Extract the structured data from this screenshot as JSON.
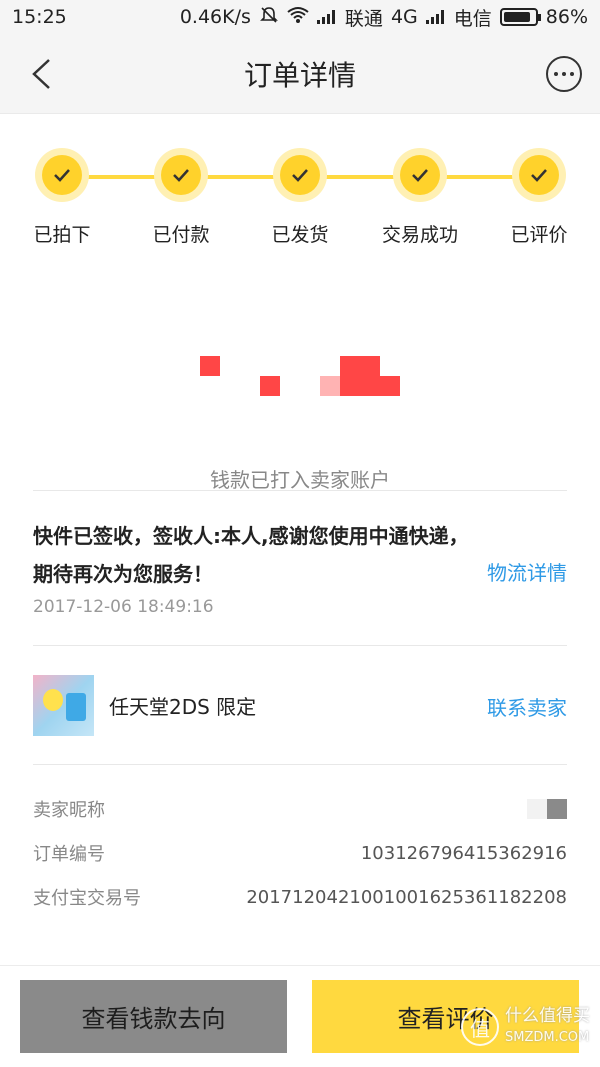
{
  "status_bar": {
    "time": "15:25",
    "speed": "0.46K/s",
    "carrier1": "联通",
    "net1": "4G",
    "carrier2": "电信",
    "battery": "86%"
  },
  "nav": {
    "title": "订单详情"
  },
  "steps": [
    {
      "label": "已拍下"
    },
    {
      "label": "已付款"
    },
    {
      "label": "已发货"
    },
    {
      "label": "交易成功"
    },
    {
      "label": "已评价"
    }
  ],
  "status": {
    "message": "钱款已打入卖家账户"
  },
  "logistics": {
    "message": "快件已签收，签收人:本人,感谢您使用中通快递，期待再次为您服务！",
    "time": "2017-12-06 18:49:16",
    "link": "物流详情"
  },
  "product": {
    "name": "任天堂2DS 限定",
    "contact": "联系卖家"
  },
  "info": {
    "seller_label": "卖家昵称",
    "order_label": "订单编号",
    "order_value": "103126796415362916",
    "alipay_label": "支付宝交易号",
    "alipay_value": "2017120421001001625361182208"
  },
  "buttons": {
    "money_flow": "查看钱款去向",
    "review": "查看评价"
  },
  "watermark": {
    "brand": "什么值得买",
    "site": "SMZDM.COM",
    "logo": "值"
  },
  "colors": {
    "accent": "#ffd93f",
    "link": "#2f9ae6",
    "gray_button": "#8a8a8a"
  }
}
